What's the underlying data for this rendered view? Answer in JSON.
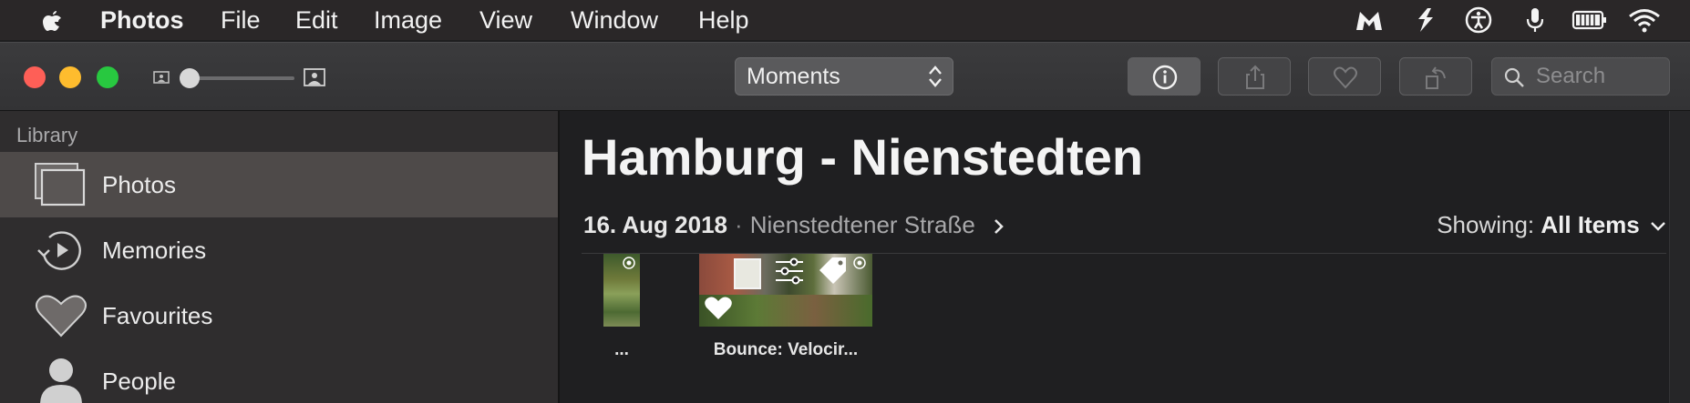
{
  "menubar": {
    "app_name": "Photos",
    "items": [
      "File",
      "Edit",
      "Image",
      "View",
      "Window",
      "Help"
    ],
    "status_icons": [
      "malwarebytes-icon",
      "taskbox-icon",
      "accessibility-icon",
      "microphone-icon",
      "battery-icon",
      "wifi-icon"
    ]
  },
  "toolbar": {
    "view_selector": "Moments",
    "search_placeholder": "Search",
    "buttons": [
      "info",
      "share",
      "favourite",
      "rotate"
    ]
  },
  "sidebar": {
    "section_title": "Library",
    "items": [
      {
        "label": "Photos",
        "icon": "photos-icon",
        "selected": true
      },
      {
        "label": "Memories",
        "icon": "memories-icon",
        "selected": false
      },
      {
        "label": "Favourites",
        "icon": "heart-icon",
        "selected": false
      },
      {
        "label": "People",
        "icon": "person-icon",
        "selected": false
      }
    ]
  },
  "moment": {
    "title": "Hamburg - Nienstedten",
    "date": "16. Aug 2018",
    "separator": "·",
    "location": "Nienstedtener Straße",
    "showing_label": "Showing:",
    "showing_value": "All Items"
  },
  "photos": [
    {
      "caption": "...",
      "badges": [
        "live-photo-icon"
      ]
    },
    {
      "caption": "Bounce: Velocir...",
      "badges": [
        "favourite-heart-icon",
        "adjustments-icon",
        "tag-icon",
        "live-photo-icon"
      ]
    }
  ],
  "colors": {
    "close": "#fe5f57",
    "minimize": "#febc2e",
    "zoom": "#28c840",
    "selected_sidebar": "#4e4a49"
  }
}
